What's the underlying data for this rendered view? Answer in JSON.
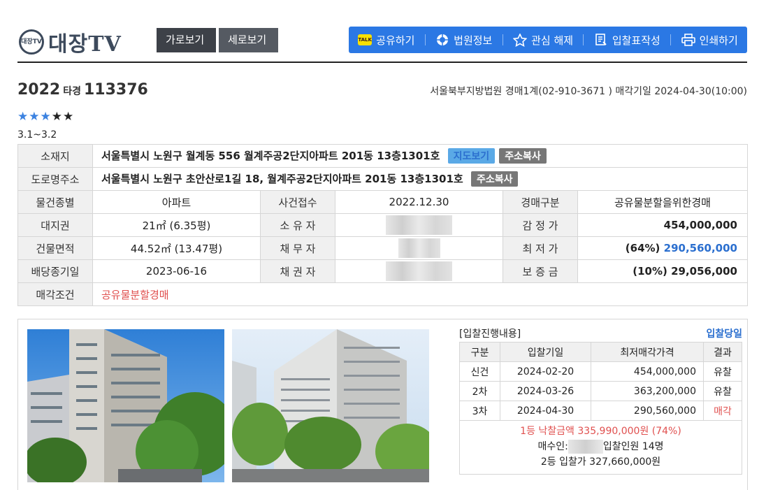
{
  "header": {
    "logo_badge": "대장TV",
    "logo_text": "대장TV",
    "view_horizontal": "가로보기",
    "view_vertical": "세로보기",
    "toolbar": {
      "share": "공유하기",
      "court_info": "법원정보",
      "unfavorite": "관심 해제",
      "bid_form": "입찰표작성",
      "print": "인쇄하기",
      "talk_badge": "TALK"
    }
  },
  "case": {
    "year": "2022",
    "kind": "타경",
    "number": "113376",
    "court_line": "서울북부지방법원 경매1계(02-910-3671 ) 매각기일 2024-04-30(10:00)",
    "rating_stars": 3,
    "rating_max": 5,
    "rating_range": "3.1~3.2"
  },
  "info": {
    "location_label": "소재지",
    "location": "서울특별시 노원구 월계동 556 월계주공2단지아파트 201동 13층1301호",
    "map_button": "지도보기",
    "copy_address_button": "주소복사",
    "road_label": "도로명주소",
    "road_address": "서울특별시 노원구 초안산로1길 18, 월계주공2단지아파트 201동 13층1301호",
    "type_label": "물건종별",
    "type": "아파트",
    "received_label": "사건접수",
    "received": "2022.12.30",
    "auction_type_label": "경매구분",
    "auction_type": "공유물분할을위한경매",
    "land_label": "대지권",
    "land": "21㎡ (6.35평)",
    "owner_label": "소 유 자",
    "appraisal_label": "감 정 가",
    "appraisal": "454,000,000",
    "building_label": "건물면적",
    "building": "44.52㎡ (13.47평)",
    "debtor_label": "채 무 자",
    "min_price_label": "최 저 가",
    "min_price_pct": "(64%)",
    "min_price": "290,560,000",
    "dividend_label": "배당종기일",
    "dividend": "2023-06-16",
    "creditor_label": "채 권 자",
    "deposit_label": "보 증 금",
    "deposit": "(10%) 29,056,000",
    "condition_label": "매각조건",
    "condition": "공유물분할경매"
  },
  "bids": {
    "title": "[입찰진행내용]",
    "today_link": "입찰당일",
    "headers": [
      "구분",
      "입찰기일",
      "최저매각가격",
      "결과"
    ],
    "rows": [
      {
        "round": "신건",
        "date": "2024-02-20",
        "price": "454,000,000",
        "result": "유찰"
      },
      {
        "round": "2차",
        "date": "2024-03-26",
        "price": "363,200,000",
        "result": "유찰"
      },
      {
        "round": "3차",
        "date": "2024-04-30",
        "price": "290,560,000",
        "result": "매각"
      }
    ],
    "winning": "1등 낙찰금액 335,990,000원 (74%)",
    "buyer_prefix": "매수인:",
    "bidders": "입찰인원 14명",
    "second": "2등 입찰가 327,660,000원"
  },
  "colors": {
    "toolbar": "#2b78e4",
    "accent_red": "#e0504f",
    "accent_blue": "#2b6fcf"
  }
}
